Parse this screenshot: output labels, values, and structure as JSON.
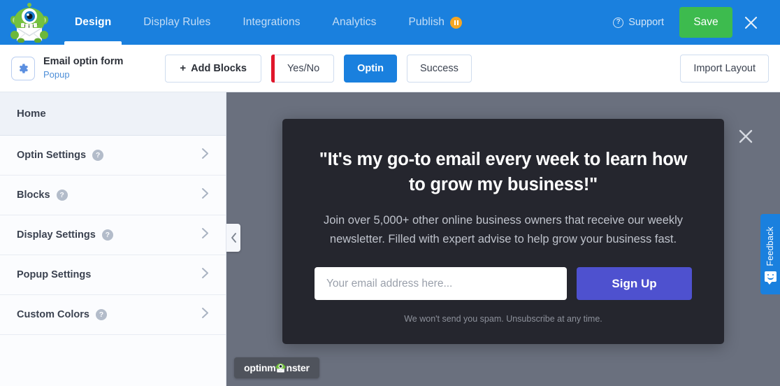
{
  "topnav": {
    "logo_name": "optinmonster-mascot-logo",
    "tabs": [
      {
        "label": "Design",
        "active": true
      },
      {
        "label": "Display Rules",
        "active": false
      },
      {
        "label": "Integrations",
        "active": false
      },
      {
        "label": "Analytics",
        "active": false
      },
      {
        "label": "Publish",
        "active": false,
        "badge": "paused"
      }
    ],
    "support_label": "Support",
    "save_label": "Save",
    "close_label": "Close",
    "bg_color": "#1a80de",
    "save_color": "#3dbb4e",
    "badge_color": "#f5a623"
  },
  "toolbar": {
    "campaign_title": "Email optin form",
    "campaign_type": "Popup",
    "add_blocks_label": "Add Blocks",
    "add_blocks_plus": "+",
    "views": [
      {
        "label": "Yes/No",
        "active": false,
        "accent": "#e0162b"
      },
      {
        "label": "Optin",
        "active": true
      },
      {
        "label": "Success",
        "active": false
      }
    ],
    "import_layout_label": "Import Layout"
  },
  "sidebar": {
    "home_label": "Home",
    "items": [
      {
        "label": "Optin Settings",
        "help": "?",
        "chevron": "chevron-right"
      },
      {
        "label": "Blocks",
        "help": "?",
        "chevron": "chevron-right"
      },
      {
        "label": "Display Settings",
        "help": "?",
        "chevron": "chevron-right"
      },
      {
        "label": "Popup Settings",
        "help": "",
        "chevron": "chevron-right"
      },
      {
        "label": "Custom Colors",
        "help": "?",
        "chevron": "chevron-right"
      }
    ],
    "collapse_label": "<"
  },
  "popup": {
    "headline": "\"It's my go-to email every week to learn how to grow my business!\"",
    "subtext": "Join over 5,000+ other online business owners that receive our weekly newsletter. Filled with expert advise to help grow your business fast.",
    "email_placeholder": "Your email address here...",
    "email_value": "",
    "signup_label": "Sign Up",
    "disclaimer": "We won't send you spam. Unsubscribe at any time.",
    "bg_color": "#25262e",
    "button_color": "#4e51cf",
    "close_label": "close-icon"
  },
  "branding": {
    "badge_text_left": "optinm",
    "badge_text_right": "nster"
  },
  "feedback": {
    "label": "Feedback",
    "color": "#1a80de"
  }
}
